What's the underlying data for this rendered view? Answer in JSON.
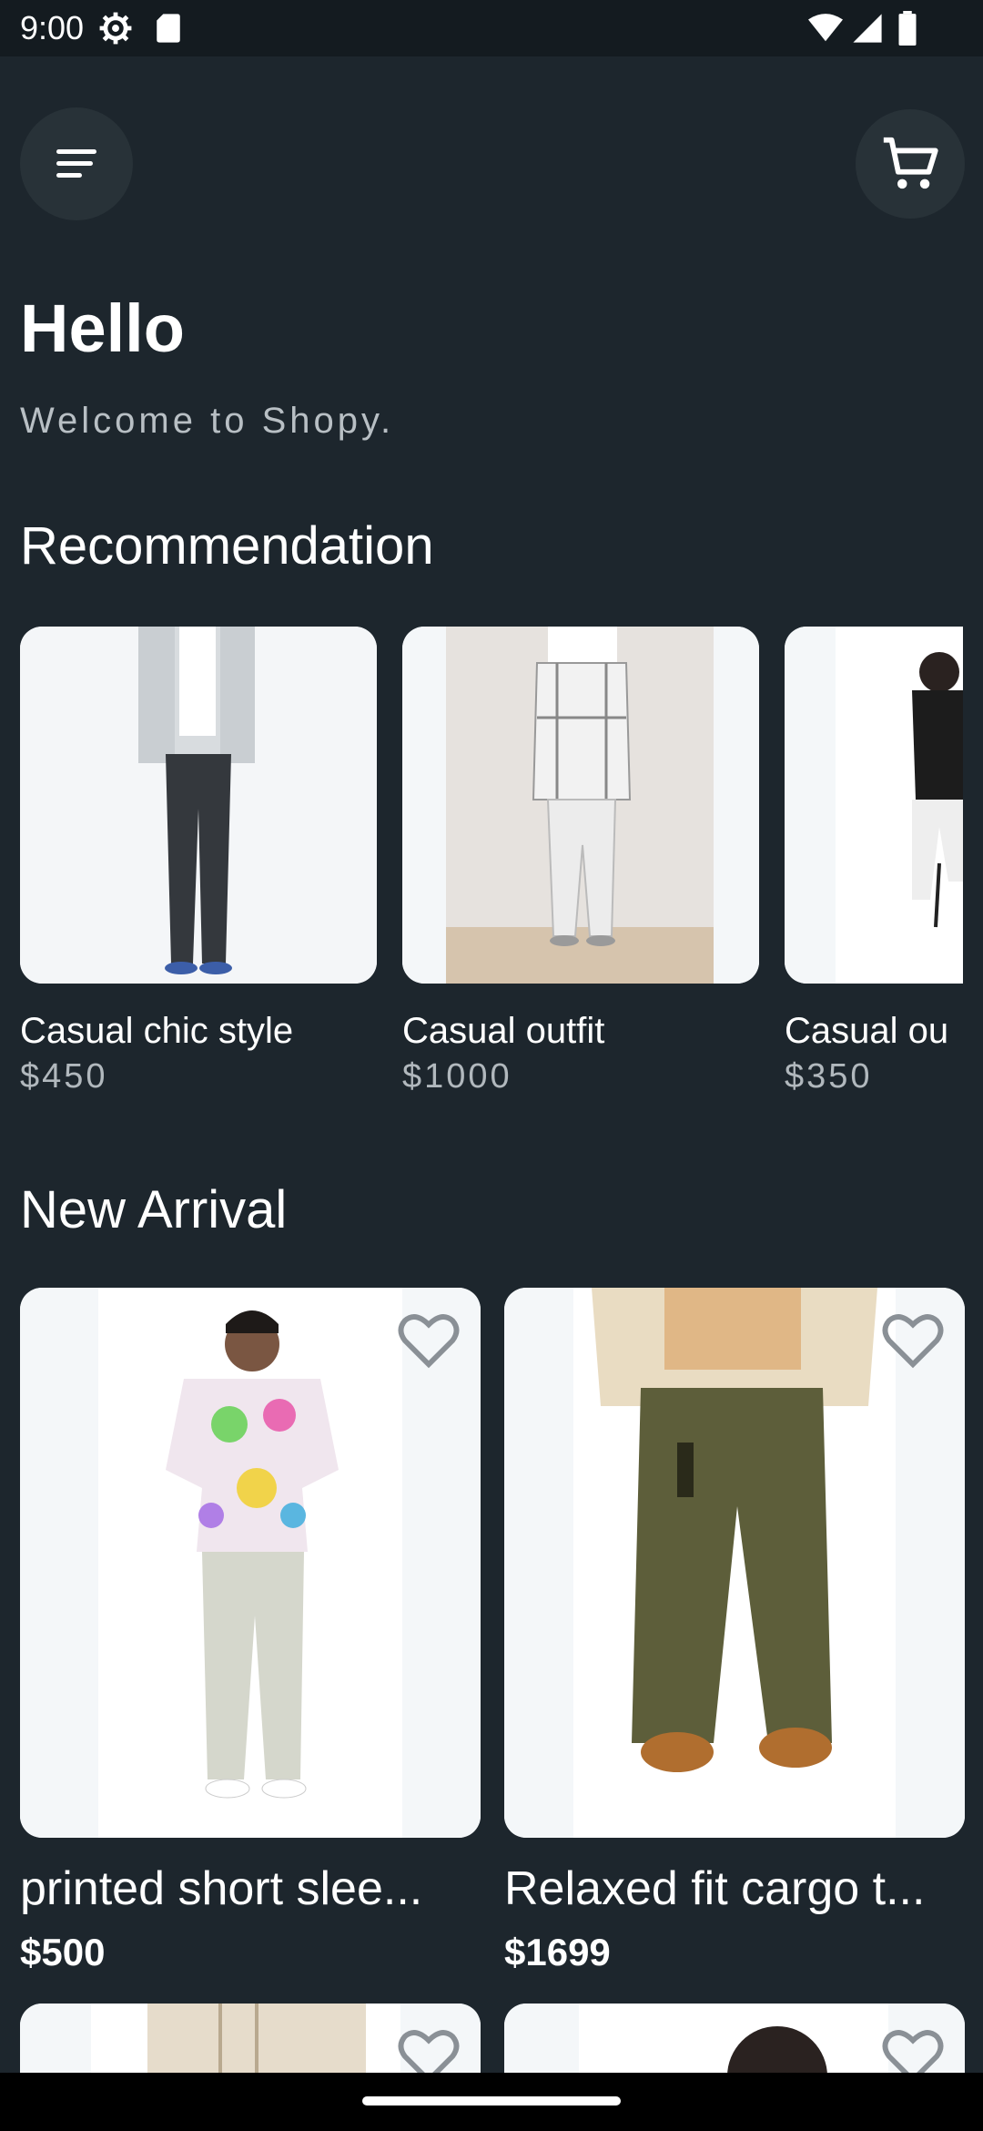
{
  "status_bar": {
    "time": "9:00",
    "icons": [
      "settings-icon",
      "sd-card-icon",
      "wifi-icon",
      "signal-icon",
      "battery-icon"
    ]
  },
  "header": {
    "menu_icon": "menu-icon",
    "cart_icon": "cart-icon"
  },
  "greeting": {
    "title": "Hello",
    "subtitle": "Welcome to Shopy."
  },
  "recommendation": {
    "title": "Recommendation",
    "items": [
      {
        "name": "Casual chic style",
        "price": "$450"
      },
      {
        "name": "Casual outfit",
        "price": "$1000"
      },
      {
        "name": "Casual ou",
        "price": "$350"
      }
    ]
  },
  "new_arrival": {
    "title": "New Arrival",
    "items": [
      {
        "name": "printed short slee...",
        "price": "$500"
      },
      {
        "name": "Relaxed fit cargo t...",
        "price": "$1699"
      }
    ]
  },
  "colors": {
    "background": "#1d262d",
    "card": "#f4f7f9",
    "button": "#283238",
    "muted_text": "#b1b8bd"
  }
}
